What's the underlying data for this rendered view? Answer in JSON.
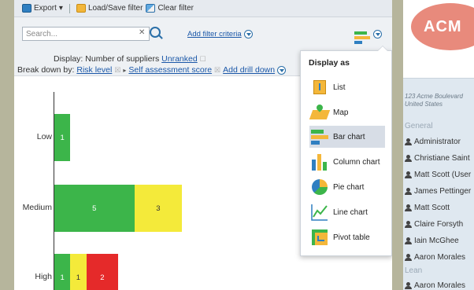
{
  "toolbar": {
    "export_label": "Export",
    "load_save_label": "Load/Save filter",
    "clear_label": "Clear filter"
  },
  "filter": {
    "search_placeholder": "Search...",
    "add_filter_label": "Add filter criteria",
    "display_prefix": "Display:",
    "display_value": "Number of suppliers",
    "display_sort": "Unranked",
    "breakdown_prefix": "Break down by:",
    "breakdown_level": "Risk level",
    "breakdown_score": "Self assessment score",
    "add_drill_down": "Add drill down"
  },
  "chart_data": {
    "type": "bar",
    "orientation": "horizontal",
    "stacked": true,
    "categories": [
      "Low",
      "Medium",
      "High"
    ],
    "series": [
      {
        "color": "#3cb54a",
        "values": [
          1,
          5,
          1
        ]
      },
      {
        "color": "#f4ea3a",
        "values": [
          0,
          3,
          1
        ]
      },
      {
        "color": "#e52a2a",
        "values": [
          0,
          0,
          2
        ]
      }
    ]
  },
  "display_as": {
    "title": "Display as",
    "items": [
      {
        "label": "List",
        "icon": "list-icon"
      },
      {
        "label": "Map",
        "icon": "map-icon"
      },
      {
        "label": "Bar chart",
        "icon": "bar-chart-icon",
        "selected": true
      },
      {
        "label": "Column chart",
        "icon": "column-chart-icon"
      },
      {
        "label": "Pie chart",
        "icon": "pie-chart-icon"
      },
      {
        "label": "Line chart",
        "icon": "line-chart-icon"
      },
      {
        "label": "Pivot table",
        "icon": "pivot-table-icon"
      }
    ]
  },
  "sidebar": {
    "logo_text": "ACM",
    "address_line1": "123 Acme Boulevard",
    "address_line2": "United States",
    "general_label": "General",
    "general_users": [
      "Administrator",
      "Christiane Saint",
      "Matt Scott (User",
      "James Pettinger",
      "Matt Scott",
      "Claire Forsyth",
      "Iain McGhee",
      "Aaron Morales"
    ],
    "lean_label": "Lean",
    "lean_users": [
      "Aaron Morales"
    ]
  },
  "colors": {
    "green": "#3cb54a",
    "yellow": "#f4ea3a",
    "red": "#e52a2a",
    "link": "#1a57a8",
    "selected_row": "#d7dde6"
  }
}
